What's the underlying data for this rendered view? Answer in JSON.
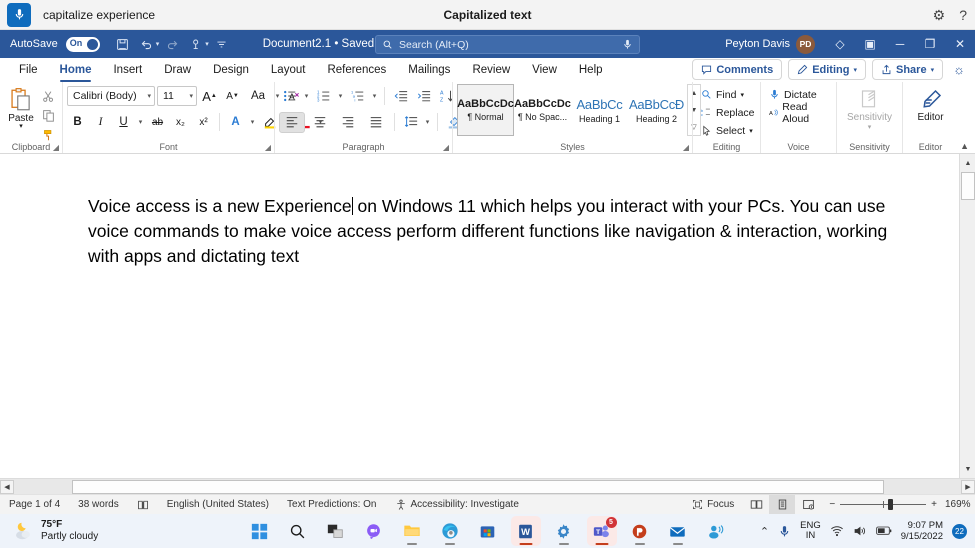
{
  "voice_access": {
    "mic_icon": "microphone-icon",
    "status_text": "capitalize experience",
    "title": "Capitalized text",
    "settings_icon": "gear-icon",
    "help_icon": "help-icon"
  },
  "title_bar": {
    "autosave_label": "AutoSave",
    "autosave_state": "On",
    "quick_access": [
      {
        "name": "save-button",
        "glyph": "💾"
      },
      {
        "name": "undo-button",
        "glyph": "↶"
      },
      {
        "name": "redo-button",
        "glyph": "↻"
      },
      {
        "name": "touch-mode-button",
        "glyph": "☝"
      },
      {
        "name": "customize-quick-access-button",
        "glyph": "▾"
      }
    ],
    "document_name": "Document2.1 • Saved",
    "document_chevron": "⌄",
    "search_placeholder": "Search (Alt+Q)",
    "search_icon": "search-icon",
    "search_mic_icon": "microphone-icon",
    "user_name": "Peyton Davis",
    "user_initials": "PD",
    "diamond_icon": "diamond-icon",
    "ribbon_display_icon": "ribbon-display-options-icon",
    "minimize": "─",
    "restore": "❐",
    "close": "✕",
    "accent_color": "#2b579a"
  },
  "ribbon": {
    "tabs": [
      {
        "label": "File",
        "active": false
      },
      {
        "label": "Home",
        "active": true
      },
      {
        "label": "Insert",
        "active": false
      },
      {
        "label": "Draw",
        "active": false
      },
      {
        "label": "Design",
        "active": false
      },
      {
        "label": "Layout",
        "active": false
      },
      {
        "label": "References",
        "active": false
      },
      {
        "label": "Mailings",
        "active": false
      },
      {
        "label": "Review",
        "active": false
      },
      {
        "label": "View",
        "active": false
      },
      {
        "label": "Help",
        "active": false
      }
    ],
    "comments_label": "Comments",
    "editing_label": "Editing",
    "share_label": "Share",
    "collapse_icon": "collapse-ribbon-icon",
    "groups": {
      "clipboard": {
        "label": "Clipboard",
        "paste_label": "Paste",
        "cut_icon": "scissors-icon",
        "copy_icon": "copy-icon",
        "format_painter_icon": "format-painter-icon",
        "launcher_icon": "dialog-launcher-icon"
      },
      "font": {
        "label": "Font",
        "font_name": "Calibri (Body)",
        "font_size": "11",
        "grow_font": "A",
        "shrink_font": "A",
        "change_case": "Aa",
        "clear_formatting": "A",
        "bold": "B",
        "italic": "I",
        "underline": "U",
        "strikethrough": "ab",
        "subscript": "x₂",
        "superscript": "x²",
        "text_effects": "A",
        "highlight": "A",
        "font_color": "A",
        "launcher_icon": "dialog-launcher-icon"
      },
      "paragraph": {
        "label": "Paragraph",
        "bullets_icon": "bullet-list-icon",
        "numbering_icon": "numbered-list-icon",
        "multilevel_icon": "multilevel-list-icon",
        "decrease_indent_icon": "decrease-indent-icon",
        "increase_indent_icon": "increase-indent-icon",
        "sort_icon": "sort-icon",
        "show_marks_icon": "paragraph-marks-icon",
        "align_left_icon": "align-left-icon",
        "align_center_icon": "align-center-icon",
        "align_right_icon": "align-right-icon",
        "justify_icon": "justify-icon",
        "line_spacing_icon": "line-spacing-icon",
        "shading_icon": "shading-icon",
        "borders_icon": "borders-icon",
        "launcher_icon": "dialog-launcher-icon"
      },
      "styles": {
        "label": "Styles",
        "items": [
          {
            "preview": "AaBbCcDc",
            "name": "¶ Normal",
            "selected": true,
            "heading": false
          },
          {
            "preview": "AaBbCcDc",
            "name": "¶ No Spac...",
            "selected": false,
            "heading": false
          },
          {
            "preview": "AaBbCс",
            "name": "Heading 1",
            "selected": false,
            "heading": true
          },
          {
            "preview": "AaBbCcĐ",
            "name": "Heading 2",
            "selected": false,
            "heading": true
          }
        ],
        "launcher_icon": "dialog-launcher-icon"
      },
      "editing": {
        "label": "Editing",
        "find_label": "Find",
        "replace_label": "Replace",
        "select_label": "Select"
      },
      "voice": {
        "label": "Voice",
        "dictate_label": "Dictate",
        "read_aloud_label": "Read Aloud"
      },
      "sensitivity": {
        "label": "Sensitivity",
        "button_label": "Sensitivity"
      },
      "editor": {
        "label": "Editor",
        "button_label": "Editor"
      }
    }
  },
  "document": {
    "paragraph_before_caret": "Voice access is a new Experience",
    "paragraph_after_caret": " on Windows 11 which helps you interact with your PCs. You can use voice commands to make voice access perform different functions like navigation & interaction, working with apps and dictating text"
  },
  "status_bar": {
    "page": "Page 1 of 4",
    "words": "38 words",
    "proofing_icon": "proofing-icon",
    "language": "English (United States)",
    "text_predictions": "Text Predictions: On",
    "accessibility_icon": "accessibility-icon",
    "accessibility": "Accessibility: Investigate",
    "focus_label": "Focus",
    "focus_icon": "focus-icon",
    "view_read_icon": "read-mode-icon",
    "view_print_icon": "print-layout-icon",
    "view_web_icon": "web-layout-icon",
    "zoom_out": "−",
    "zoom_in": "+",
    "zoom_level": "169%"
  },
  "taskbar": {
    "weather_temp": "75°F",
    "weather_desc": "Partly cloudy",
    "weather_icon": "partly-cloudy-night-icon",
    "apps": [
      {
        "name": "start-button",
        "icon": "windows-logo-icon",
        "running": false,
        "active": false,
        "badge": ""
      },
      {
        "name": "search-button",
        "icon": "search-icon",
        "running": false,
        "active": false,
        "badge": ""
      },
      {
        "name": "task-view-button",
        "icon": "task-view-icon",
        "running": false,
        "active": false,
        "badge": ""
      },
      {
        "name": "chat-button",
        "icon": "chat-icon",
        "running": false,
        "active": false,
        "badge": ""
      },
      {
        "name": "file-explorer-button",
        "icon": "folder-icon",
        "running": true,
        "active": false,
        "badge": ""
      },
      {
        "name": "edge-button",
        "icon": "edge-icon",
        "running": true,
        "active": false,
        "badge": ""
      },
      {
        "name": "microsoft-store-button",
        "icon": "store-icon",
        "running": false,
        "active": false,
        "badge": ""
      },
      {
        "name": "word-button",
        "icon": "word-icon",
        "running": true,
        "active": true,
        "badge": ""
      },
      {
        "name": "settings-button",
        "icon": "settings-gear-icon",
        "running": true,
        "active": false,
        "badge": ""
      },
      {
        "name": "teams-button",
        "icon": "teams-icon",
        "running": true,
        "active": true,
        "badge": "5"
      },
      {
        "name": "powerpoint-button",
        "icon": "powerpoint-icon",
        "running": true,
        "active": false,
        "badge": ""
      },
      {
        "name": "mail-button",
        "icon": "mail-icon",
        "running": true,
        "active": false,
        "badge": ""
      },
      {
        "name": "people-button",
        "icon": "people-icon",
        "running": false,
        "active": false,
        "badge": ""
      }
    ],
    "tray": {
      "chevron": "⌃",
      "mic_icon": "microphone-icon",
      "lang_line1": "ENG",
      "lang_line2": "IN",
      "wifi_icon": "wifi-icon",
      "volume_icon": "volume-icon",
      "battery_icon": "battery-icon",
      "time": "9:07 PM",
      "date": "9/15/2022",
      "notification_count": "22"
    }
  }
}
